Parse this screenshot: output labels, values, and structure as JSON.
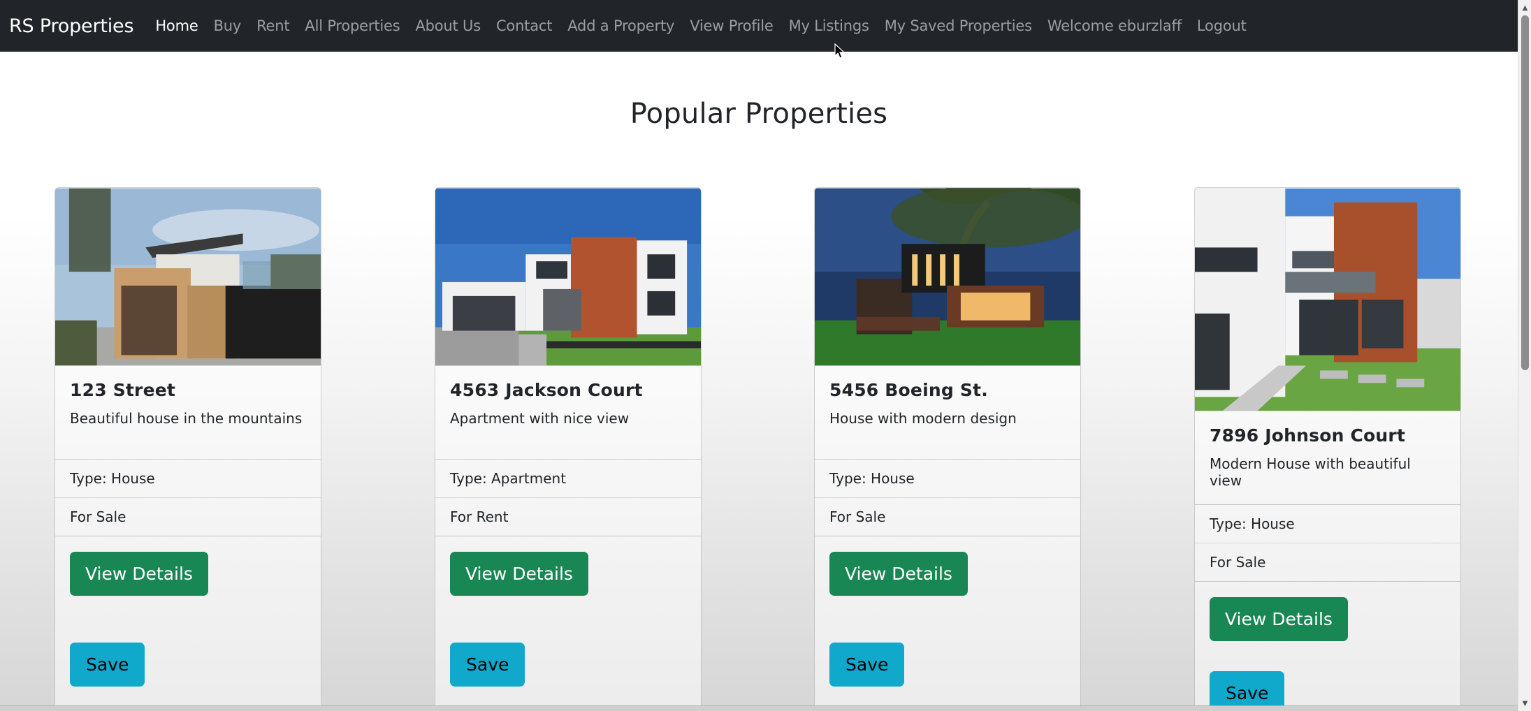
{
  "navbar": {
    "brand": "RS Properties",
    "links": [
      {
        "label": "Home",
        "active": true
      },
      {
        "label": "Buy"
      },
      {
        "label": "Rent"
      },
      {
        "label": "All Properties"
      },
      {
        "label": "About Us"
      },
      {
        "label": "Contact"
      },
      {
        "label": "Add a Property"
      },
      {
        "label": "View Profile"
      },
      {
        "label": "My Listings"
      },
      {
        "label": "My Saved Properties"
      },
      {
        "label": "Welcome eburzlaff"
      },
      {
        "label": "Logout"
      }
    ]
  },
  "main": {
    "heading": "Popular Properties",
    "cards": [
      {
        "title": "123 Street",
        "description": "Beautiful house in the mountains",
        "type": "Type: House",
        "status": "For Sale",
        "view_label": "View Details",
        "save_label": "Save"
      },
      {
        "title": "4563 Jackson Court",
        "description": "Apartment with nice view",
        "type": "Type: Apartment",
        "status": "For Rent",
        "view_label": "View Details",
        "save_label": "Save"
      },
      {
        "title": "5456 Boeing St.",
        "description": "House with modern design",
        "type": "Type: House",
        "status": "For Sale",
        "view_label": "View Details",
        "save_label": "Save"
      },
      {
        "title": "7896 Johnson Court",
        "description": "Modern House with beautiful view",
        "type": "Type: House",
        "status": "For Sale",
        "view_label": "View Details",
        "save_label": "Save"
      }
    ]
  },
  "colors": {
    "navbar_bg": "#212529",
    "view_button": "#198754",
    "save_button": "#10a9cc"
  }
}
